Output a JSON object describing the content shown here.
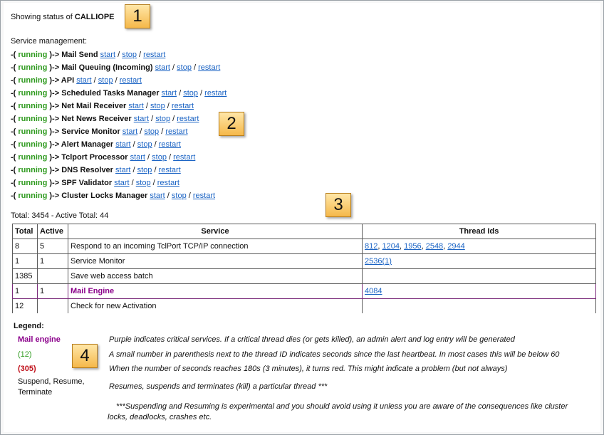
{
  "header": {
    "status_prefix": "Showing status of",
    "server_name": "CALLIOPE",
    "service_mgmt_title": "Service management:"
  },
  "services": [
    {
      "status": "running",
      "name": "Mail Send"
    },
    {
      "status": "running",
      "name": "Mail Queuing (Incoming)"
    },
    {
      "status": "running",
      "name": "API"
    },
    {
      "status": "running",
      "name": "Scheduled Tasks Manager"
    },
    {
      "status": "running",
      "name": "Net Mail Receiver"
    },
    {
      "status": "running",
      "name": "Net News Receiver"
    },
    {
      "status": "running",
      "name": "Service Monitor"
    },
    {
      "status": "running",
      "name": "Alert Manager"
    },
    {
      "status": "running",
      "name": "Tclport Processor"
    },
    {
      "status": "running",
      "name": "DNS Resolver"
    },
    {
      "status": "running",
      "name": "SPF Validator"
    },
    {
      "status": "running",
      "name": "Cluster Locks Manager"
    }
  ],
  "actions": {
    "start": "start",
    "stop": "stop",
    "restart": "restart",
    "prefix": "-(",
    "arrow": ")->"
  },
  "totals": {
    "text": "Total: 3454 - Active Total: 44"
  },
  "table": {
    "headers": [
      "Total",
      "Active",
      "Service",
      "Thread Ids"
    ],
    "rows": [
      {
        "total": "8",
        "active": "5",
        "service": "Respond to an incoming TclPort TCP/IP connection",
        "threads": [
          "812",
          "1204",
          "1956",
          "2548",
          "2944"
        ],
        "hb": ""
      },
      {
        "total": "1",
        "active": "1",
        "service": "Service Monitor",
        "threads": [
          "2536"
        ],
        "hb": "(1)"
      },
      {
        "total": "1385",
        "active": "",
        "service": "Save web access batch",
        "threads": [],
        "hb": ""
      },
      {
        "total": "1",
        "active": "1",
        "service": "Mail Engine",
        "threads": [
          "4084"
        ],
        "hb": "",
        "critical": true
      },
      {
        "total": "12",
        "active": "",
        "service": "Check for new Activation",
        "threads": [],
        "hb": ""
      }
    ]
  },
  "legend": {
    "title": "Legend:",
    "items": [
      {
        "key": "Mail engine",
        "desc": "Purple indicates critical services. If a critical thread dies (or gets killed), an admin alert and log entry will be generated"
      },
      {
        "key": "(12)",
        "desc": "A small number in parenthesis next to the thread ID indicates seconds since the last heartbeat. In most cases this will be below 60"
      },
      {
        "key": "(305)",
        "desc": "When the number of seconds reaches 180s (3 minutes), it turns red. This might indicate a problem (but not always)"
      },
      {
        "key": "Suspend, Resume, Terminate",
        "desc": "Resumes, suspends and terminates (kill) a particular thread ***"
      }
    ],
    "note": "***Suspending and Resuming is experimental and you should avoid using it unless you are aware of the consequences like cluster locks, deadlocks, crashes etc."
  },
  "badges": [
    "1",
    "2",
    "3",
    "4"
  ],
  "colors": {
    "running": "#2e9a1e",
    "link": "#1a63c4",
    "critical": "#8b008b",
    "warning": "#c0101a",
    "badge": "#f5b84a"
  }
}
